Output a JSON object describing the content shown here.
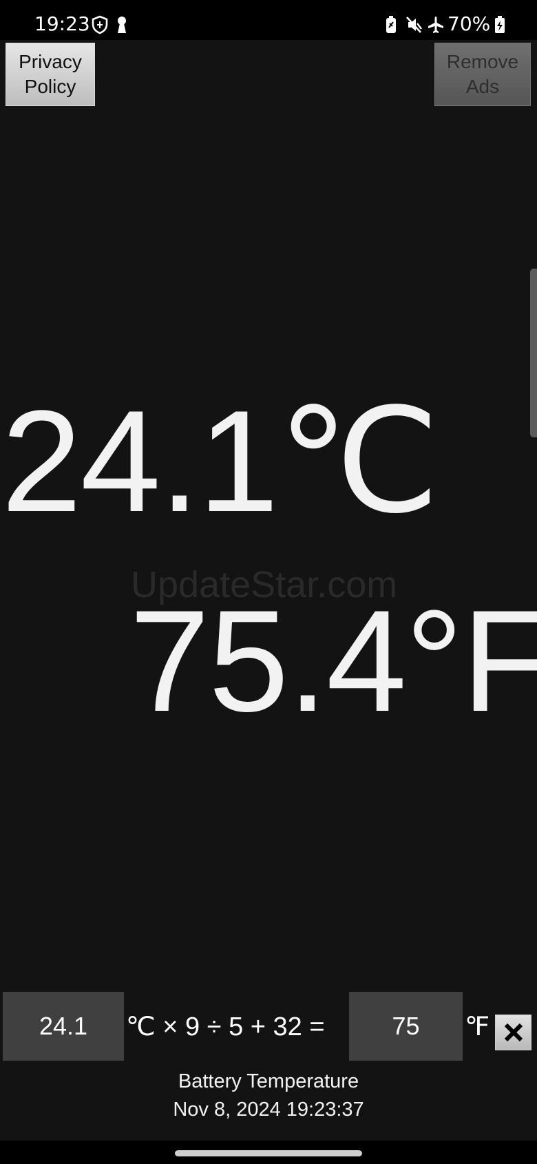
{
  "status_bar": {
    "time": "19:23",
    "battery_percent": "70%",
    "left_icons": [
      "shield-icon",
      "keyhole-icon"
    ],
    "right_icons": [
      "battery-saver-icon",
      "mute-icon",
      "airplane-icon",
      "battery-charging-icon"
    ]
  },
  "toolbar": {
    "privacy_label_line1": "Privacy",
    "privacy_label_line2": "Policy",
    "remove_ads_line1": "Remove",
    "remove_ads_line2": "Ads"
  },
  "readouts": {
    "celsius": "24.1℃",
    "fahrenheit": "75.4°F",
    "watermark": "UpdateStar.com"
  },
  "converter": {
    "celsius_value": "24.1",
    "formula": "℃ × 9 ÷ 5 + 32 =",
    "fahrenheit_value": "75",
    "unit": "℉",
    "close_icon": "close-icon"
  },
  "footer": {
    "title": "Battery Temperature",
    "timestamp": "Nov 8, 2024 19:23:37"
  },
  "colors": {
    "background": "#131313",
    "text": "#f2f2f2",
    "input_bg": "#404040"
  }
}
